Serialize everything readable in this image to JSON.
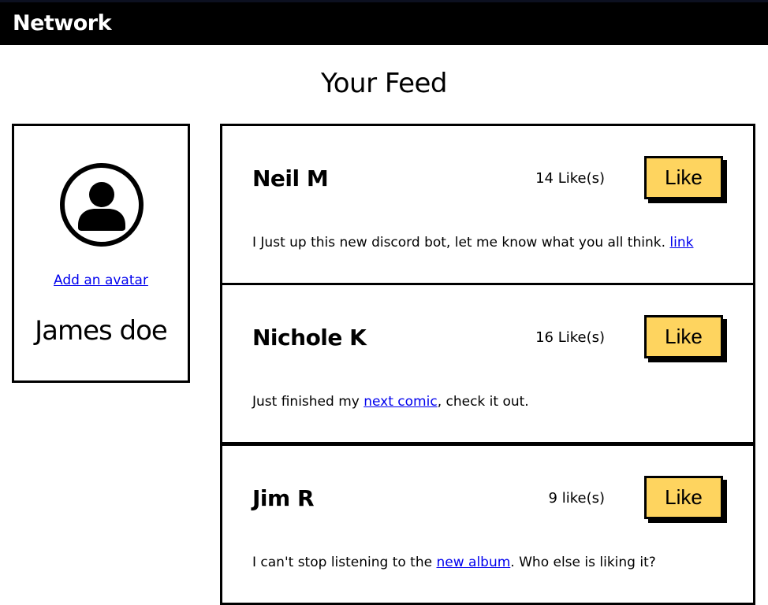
{
  "header": {
    "brand": "Network"
  },
  "page": {
    "title": "Your Feed"
  },
  "profile": {
    "add_avatar_link": "Add an avatar",
    "name": "James doe",
    "avatar_icon": "user-avatar-icon"
  },
  "posts": [
    {
      "author": "Neil M",
      "likes": "14 Like(s)",
      "like_label": "Like",
      "body_before": "I Just up this new discord bot, let me know what you all think. ",
      "link_text": "link",
      "body_after": ""
    },
    {
      "author": "Nichole K",
      "likes": "16 Like(s)",
      "like_label": "Like",
      "body_before": "Just finished my ",
      "link_text": "next comic",
      "body_after": ", check it out."
    },
    {
      "author": "Jim R",
      "likes": "9 like(s)",
      "like_label": "Like",
      "body_before": "I can't stop listening to the ",
      "link_text": "new album",
      "body_after": ". Who else is liking it?"
    }
  ],
  "colors": {
    "like_button": "#fed45f",
    "link": "#0000ee",
    "header_bg": "#000000"
  }
}
